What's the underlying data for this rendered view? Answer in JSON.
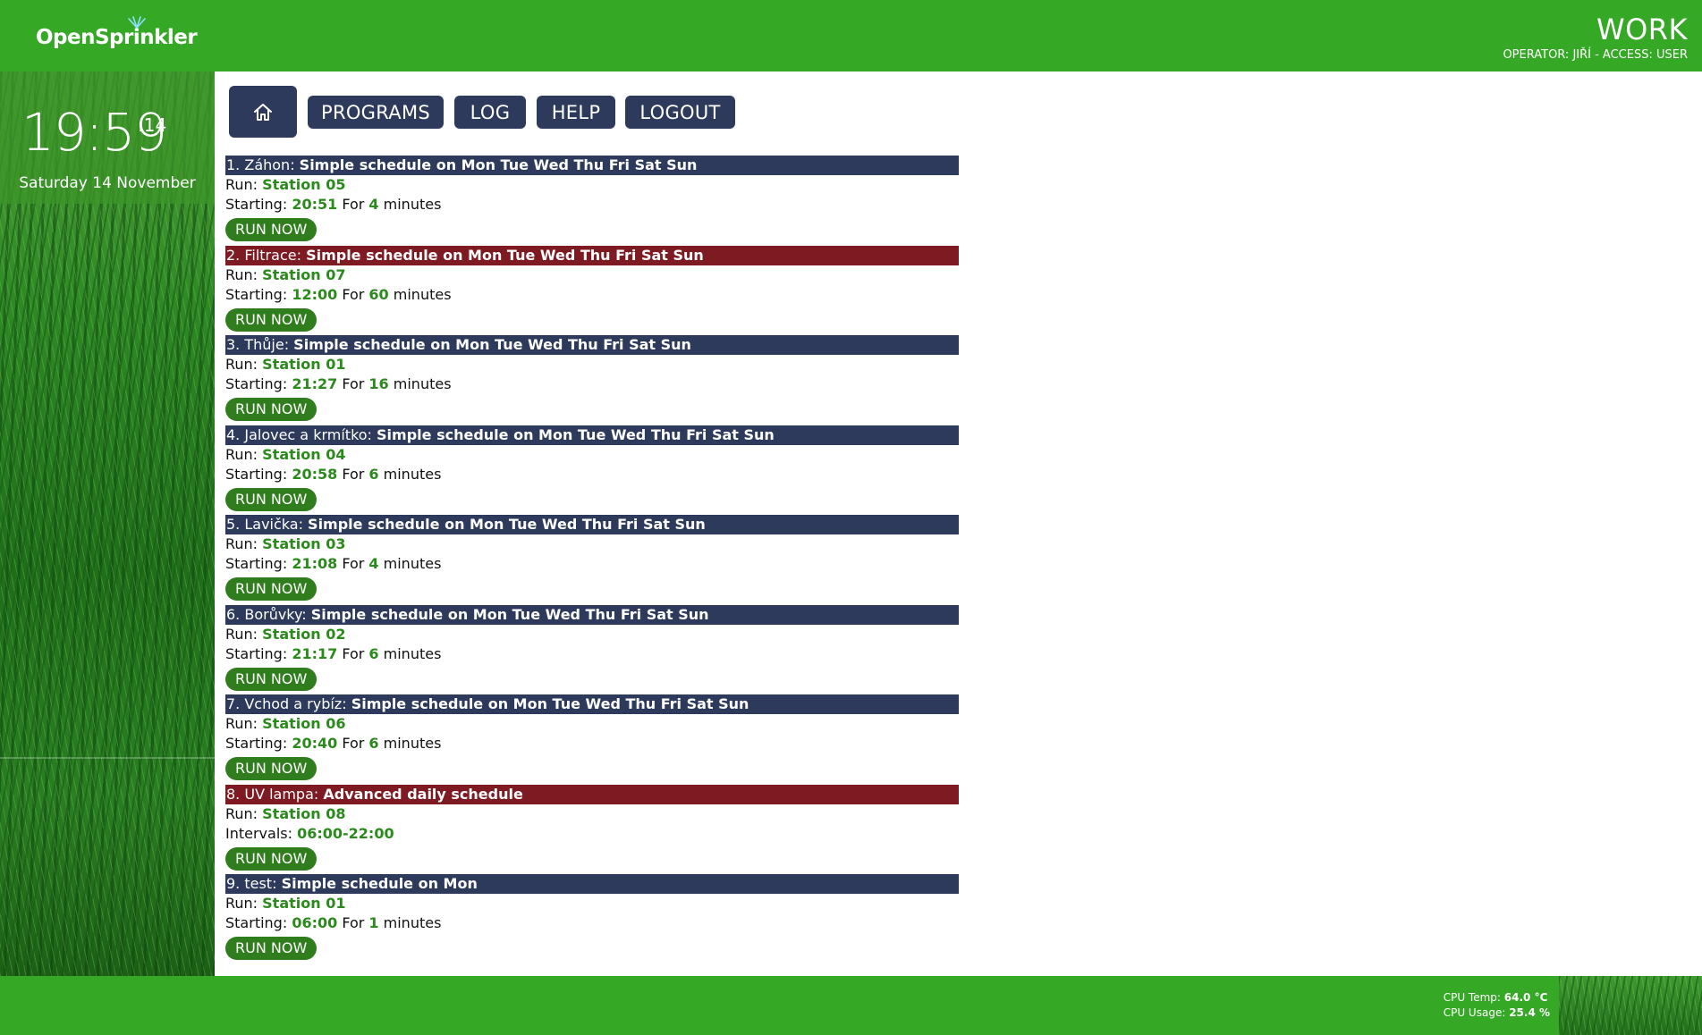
{
  "header": {
    "logo_text": "OpenSprinkler",
    "site_name": "WORK",
    "operator_line": "OPERATOR: JIŘÍ - ACCESS: USER"
  },
  "sidebar": {
    "clock_time": "19:59",
    "clock_seconds": ":14",
    "date": "Saturday 14 November"
  },
  "nav": {
    "home_icon": "home-icon",
    "programs": "PROGRAMS",
    "log": "LOG",
    "help": "HELP",
    "logout": "LOGOUT"
  },
  "labels": {
    "run": "Run: ",
    "starting": "Starting: ",
    "intervals": "Intervals: ",
    "for": " For ",
    "minutes": " minutes",
    "run_now": "RUN NOW"
  },
  "programs": [
    {
      "prefix": "1. Záhon: ",
      "schedule": "Simple schedule on Mon Tue Wed Thu Fri Sat Sun",
      "status": "blue",
      "station": "Station 05",
      "start": "20:51",
      "duration": "4"
    },
    {
      "prefix": "2. Filtrace: ",
      "schedule": "Simple schedule on Mon Tue Wed Thu Fri Sat Sun",
      "status": "red",
      "station": "Station 07",
      "start": "12:00",
      "duration": "60"
    },
    {
      "prefix": "3. Thůje: ",
      "schedule": "Simple schedule on Mon Tue Wed Thu Fri Sat Sun",
      "status": "blue",
      "station": "Station 01",
      "start": "21:27",
      "duration": "16"
    },
    {
      "prefix": "4. Jalovec a krmítko: ",
      "schedule": "Simple schedule on Mon Tue Wed Thu Fri Sat Sun",
      "status": "blue",
      "station": "Station 04",
      "start": "20:58",
      "duration": "6"
    },
    {
      "prefix": "5. Lavička: ",
      "schedule": "Simple schedule on Mon Tue Wed Thu Fri Sat Sun",
      "status": "blue",
      "station": "Station 03",
      "start": "21:08",
      "duration": "4"
    },
    {
      "prefix": "6. Borůvky: ",
      "schedule": "Simple schedule on Mon Tue Wed Thu Fri Sat Sun",
      "status": "blue",
      "station": "Station 02",
      "start": "21:17",
      "duration": "6"
    },
    {
      "prefix": "7. Vchod a rybíz: ",
      "schedule": "Simple schedule on Mon Tue Wed Thu Fri Sat Sun",
      "status": "blue",
      "station": "Station 06",
      "start": "20:40",
      "duration": "6"
    },
    {
      "prefix": "8. UV lampa: ",
      "schedule": "Advanced daily schedule",
      "status": "red",
      "station": "Station 08",
      "intervals": "06:00-22:00"
    },
    {
      "prefix": "9. test: ",
      "schedule": "Simple schedule on Mon",
      "status": "blue",
      "station": "Station 01",
      "start": "06:00",
      "duration": "1"
    }
  ],
  "footer": {
    "cpu_temp_label": "CPU Temp: ",
    "cpu_temp_value": "64.0 °C",
    "cpu_usage_label": "CPU Usage: ",
    "cpu_usage_value": "25.4 %"
  },
  "colors": {
    "header_green": "#35a826",
    "nav_blue": "#2d3a5c",
    "disabled_red": "#7d1a22",
    "value_green": "#2b8a1c",
    "run_button": "#2f7d1c"
  }
}
